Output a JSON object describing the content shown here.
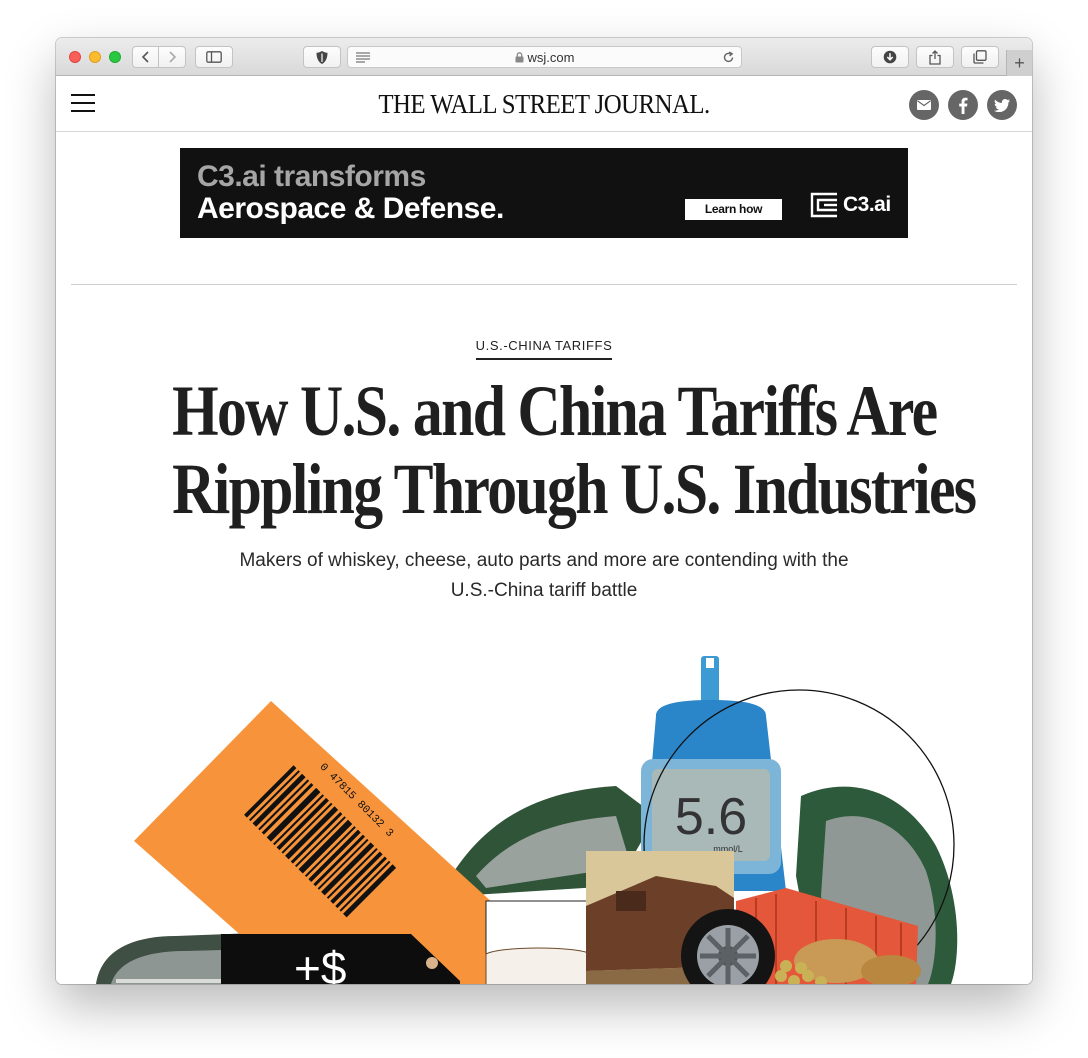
{
  "browser": {
    "url": "wsj.com"
  },
  "site": {
    "masthead": "THE WALL STREET JOURNAL."
  },
  "ad": {
    "line1": "C3.ai transforms",
    "line2": "Aerospace & Defense.",
    "cta": "Learn how",
    "brand": "C3.ai"
  },
  "article": {
    "kicker": "U.S.-CHINA TARIFFS",
    "headline_line1": "How U.S. and China Tariffs Are",
    "headline_line2": "Rippling Through U.S. Industries",
    "dek_line1": "Makers of whiskey, cheese, auto parts and more are contending with the",
    "dek_line2": "U.S.-China tariff battle"
  },
  "illustration": {
    "barcode_digits": "0 47815 80132 3",
    "price_tag": "+$",
    "meter_reading": "5.6",
    "meter_unit": "mmol/L"
  },
  "colors": {
    "ad_background": "#111111",
    "tag_orange": "#f7943b",
    "meter_blue": "#2a86c9",
    "container_red": "#e4573a",
    "social_gray": "#666666"
  }
}
